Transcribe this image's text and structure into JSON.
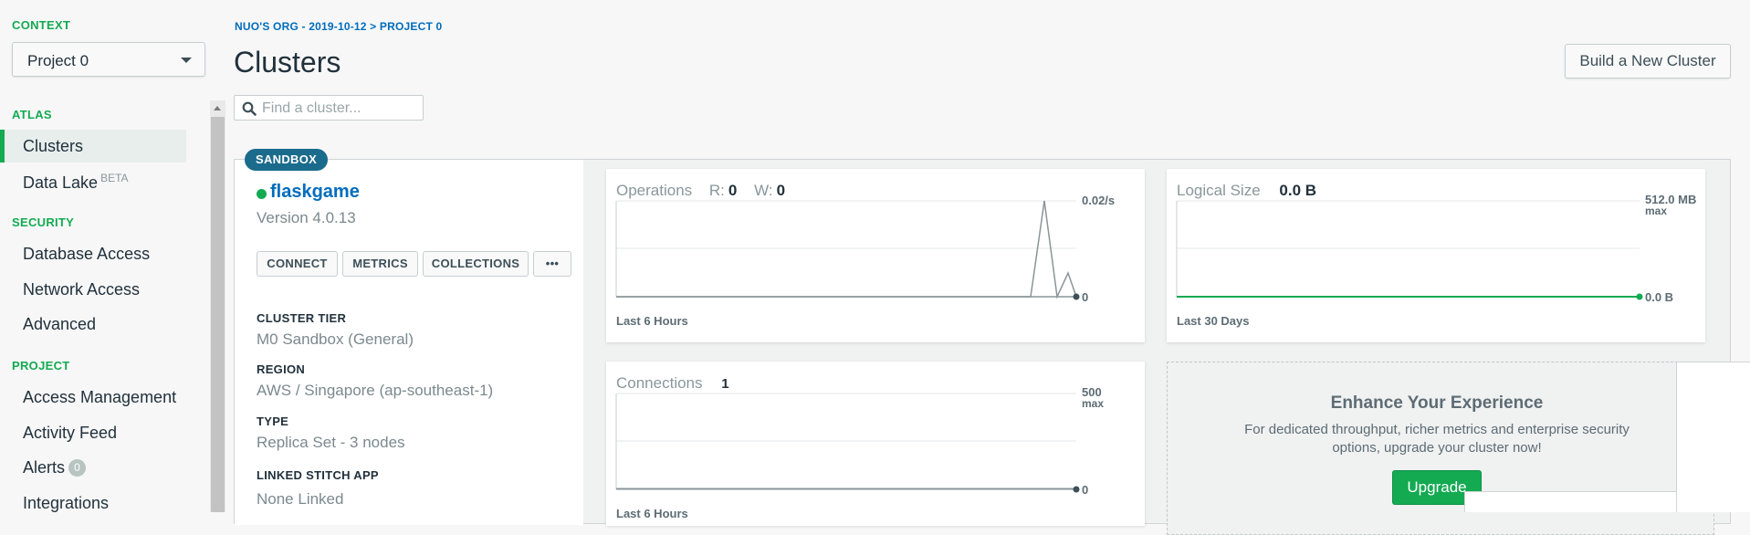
{
  "sidebar": {
    "context_label": "CONTEXT",
    "context_value": "Project 0",
    "atlas_label": "ATLAS",
    "atlas_items": [
      {
        "label": "Clusters",
        "active": true
      },
      {
        "label": "Data Lake",
        "sup": "BETA"
      }
    ],
    "security_label": "SECURITY",
    "security_items": [
      {
        "label": "Database Access"
      },
      {
        "label": "Network Access"
      },
      {
        "label": "Advanced"
      }
    ],
    "project_label": "PROJECT",
    "project_items": [
      {
        "label": "Access Management"
      },
      {
        "label": "Activity Feed"
      },
      {
        "label": "Alerts",
        "count": "0"
      },
      {
        "label": "Integrations"
      }
    ]
  },
  "header": {
    "breadcrumb": "NUO'S ORG - 2019-10-12 > PROJECT 0",
    "title": "Clusters",
    "build_button": "Build a New Cluster"
  },
  "search": {
    "placeholder": "Find a cluster..."
  },
  "cluster": {
    "badge": "SANDBOX",
    "name": "flaskgame",
    "version": "Version 4.0.13",
    "status_color": "#13aa52",
    "actions": [
      "CONNECT",
      "METRICS",
      "COLLECTIONS",
      "•••"
    ],
    "info": [
      {
        "label": "CLUSTER TIER",
        "value": "M0 Sandbox (General)"
      },
      {
        "label": "REGION",
        "value": "AWS / Singapore (ap-southeast-1)"
      },
      {
        "label": "TYPE",
        "value": "Replica Set - 3 nodes"
      },
      {
        "label": "LINKED STITCH APP",
        "value": "None Linked"
      }
    ]
  },
  "metrics": {
    "operations": {
      "title": "Operations",
      "r_label": "R:",
      "r_value": "0",
      "w_label": "W:",
      "w_value": "0",
      "max_label": "0.02/s",
      "zero_label": "0",
      "footer": "Last 6 Hours"
    },
    "logical_size": {
      "title": "Logical Size",
      "value": "0.0 B",
      "max_label": "512.0 MB",
      "max_sub": "max",
      "zero_label": "0.0 B",
      "footer": "Last 30 Days"
    },
    "connections": {
      "title": "Connections",
      "value": "1",
      "max_label": "500",
      "max_sub": "max",
      "zero_label": "0",
      "footer": "Last 6 Hours"
    }
  },
  "enhance": {
    "title": "Enhance Your Experience",
    "text": "For dedicated throughput, richer metrics and enterprise security options, upgrade your cluster now!",
    "button": "Upgrade"
  },
  "colors": {
    "accent_green": "#13aa52",
    "link_blue": "#006cbc",
    "badge_blue": "#1b6b8c"
  }
}
